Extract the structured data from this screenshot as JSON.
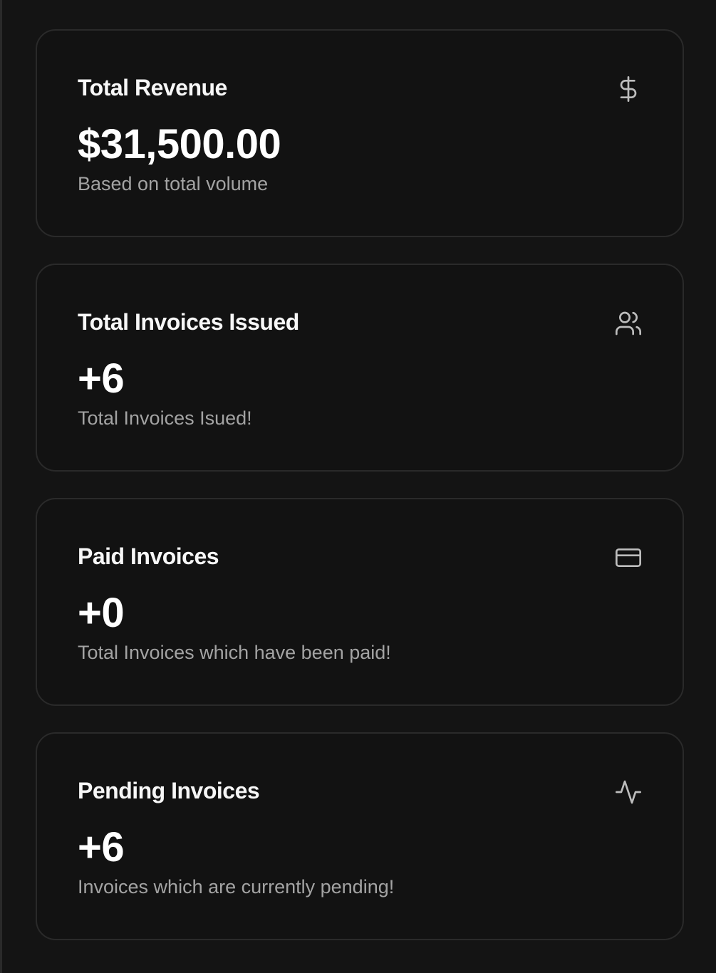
{
  "cards": [
    {
      "title": "Total Revenue",
      "value": "$31,500.00",
      "description": "Based on total volume",
      "icon": "dollar-icon"
    },
    {
      "title": "Total Invoices Issued",
      "value": "+6",
      "description": "Total Invoices Isued!",
      "icon": "users-icon"
    },
    {
      "title": "Paid Invoices",
      "value": "+0",
      "description": "Total Invoices which have been paid!",
      "icon": "credit-card-icon"
    },
    {
      "title": "Pending Invoices",
      "value": "+6",
      "description": "Invoices which are currently pending!",
      "icon": "activity-icon"
    }
  ],
  "colors": {
    "background": "#141414",
    "card_background": "#121212",
    "card_border": "#2a2a2a",
    "muted_text": "#a3a3a3",
    "icon": "#bdbdbd"
  }
}
